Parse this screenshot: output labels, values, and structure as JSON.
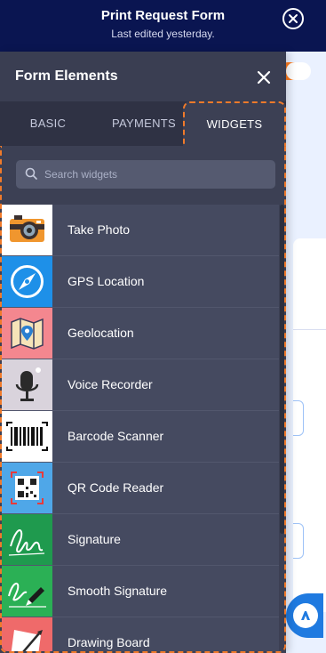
{
  "header": {
    "title": "Print Request Form",
    "subtitle": "Last edited yesterday."
  },
  "panel": {
    "title": "Form Elements",
    "tabs": [
      {
        "label": "BASIC"
      },
      {
        "label": "PAYMENTS"
      },
      {
        "label": "WIDGETS"
      }
    ],
    "active_tab": "WIDGETS",
    "search": {
      "placeholder": "Search widgets",
      "value": ""
    },
    "widgets": [
      {
        "label": "Take Photo",
        "icon": "camera-icon",
        "bg": "#ffffff"
      },
      {
        "label": "GPS Location",
        "icon": "compass-icon",
        "bg": "#1e90e8"
      },
      {
        "label": "Geolocation",
        "icon": "map-pin-icon",
        "bg": "#f4878f"
      },
      {
        "label": "Voice Recorder",
        "icon": "microphone-icon",
        "bg": "#d9d3dc"
      },
      {
        "label": "Barcode Scanner",
        "icon": "barcode-icon",
        "bg": "#ffffff"
      },
      {
        "label": "QR Code Reader",
        "icon": "qr-code-icon",
        "bg": "#4fa7e8"
      },
      {
        "label": "Signature",
        "icon": "signature-icon",
        "bg": "#1f9a4e"
      },
      {
        "label": "Smooth Signature",
        "icon": "pen-signature-icon",
        "bg": "#2bb055"
      },
      {
        "label": "Drawing Board",
        "icon": "drawing-board-icon",
        "bg": "#ef6a6a"
      }
    ]
  },
  "colors": {
    "header_bg": "#0a1551",
    "panel_bg": "#3c4054",
    "highlight": "#f07a2a",
    "accent": "#1f7ae0"
  }
}
